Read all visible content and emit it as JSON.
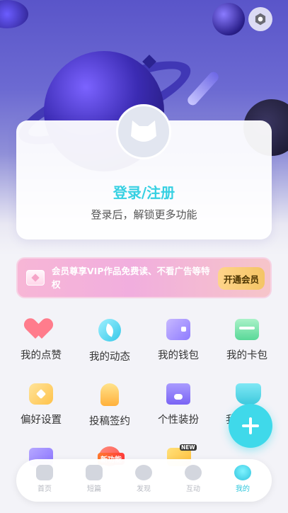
{
  "login": {
    "title": "登录/注册",
    "subtitle": "登录后，解锁更多功能"
  },
  "vip": {
    "text": "会员尊享VIP作品免费读、不看广告等特权",
    "button": "开通会员"
  },
  "grid": {
    "items": [
      {
        "label": "我的点赞",
        "icon": "heart-icon"
      },
      {
        "label": "我的动态",
        "icon": "leaf-icon"
      },
      {
        "label": "我的钱包",
        "icon": "wallet-icon"
      },
      {
        "label": "我的卡包",
        "icon": "card-icon"
      },
      {
        "label": "偏好设置",
        "icon": "preference-icon"
      },
      {
        "label": "投稿签约",
        "icon": "bulb-icon"
      },
      {
        "label": "个性装扮",
        "icon": "store-icon"
      },
      {
        "label": "我",
        "icon": "whale-icon"
      }
    ]
  },
  "badges": {
    "new_feature": "新功能",
    "new": "NEW"
  },
  "tabbar": {
    "items": [
      {
        "label": "首页",
        "icon": "home-icon"
      },
      {
        "label": "短篇",
        "icon": "short-story-icon"
      },
      {
        "label": "发现",
        "icon": "discover-icon"
      },
      {
        "label": "互动",
        "icon": "chat-icon"
      },
      {
        "label": "我的",
        "icon": "profile-icon"
      }
    ],
    "active_index": 4
  },
  "colors": {
    "accent": "#36d0e2",
    "fab": "#3fd9ea",
    "vip_gradient_start": "#f7b6d6",
    "vip_button": "#f4c565"
  }
}
